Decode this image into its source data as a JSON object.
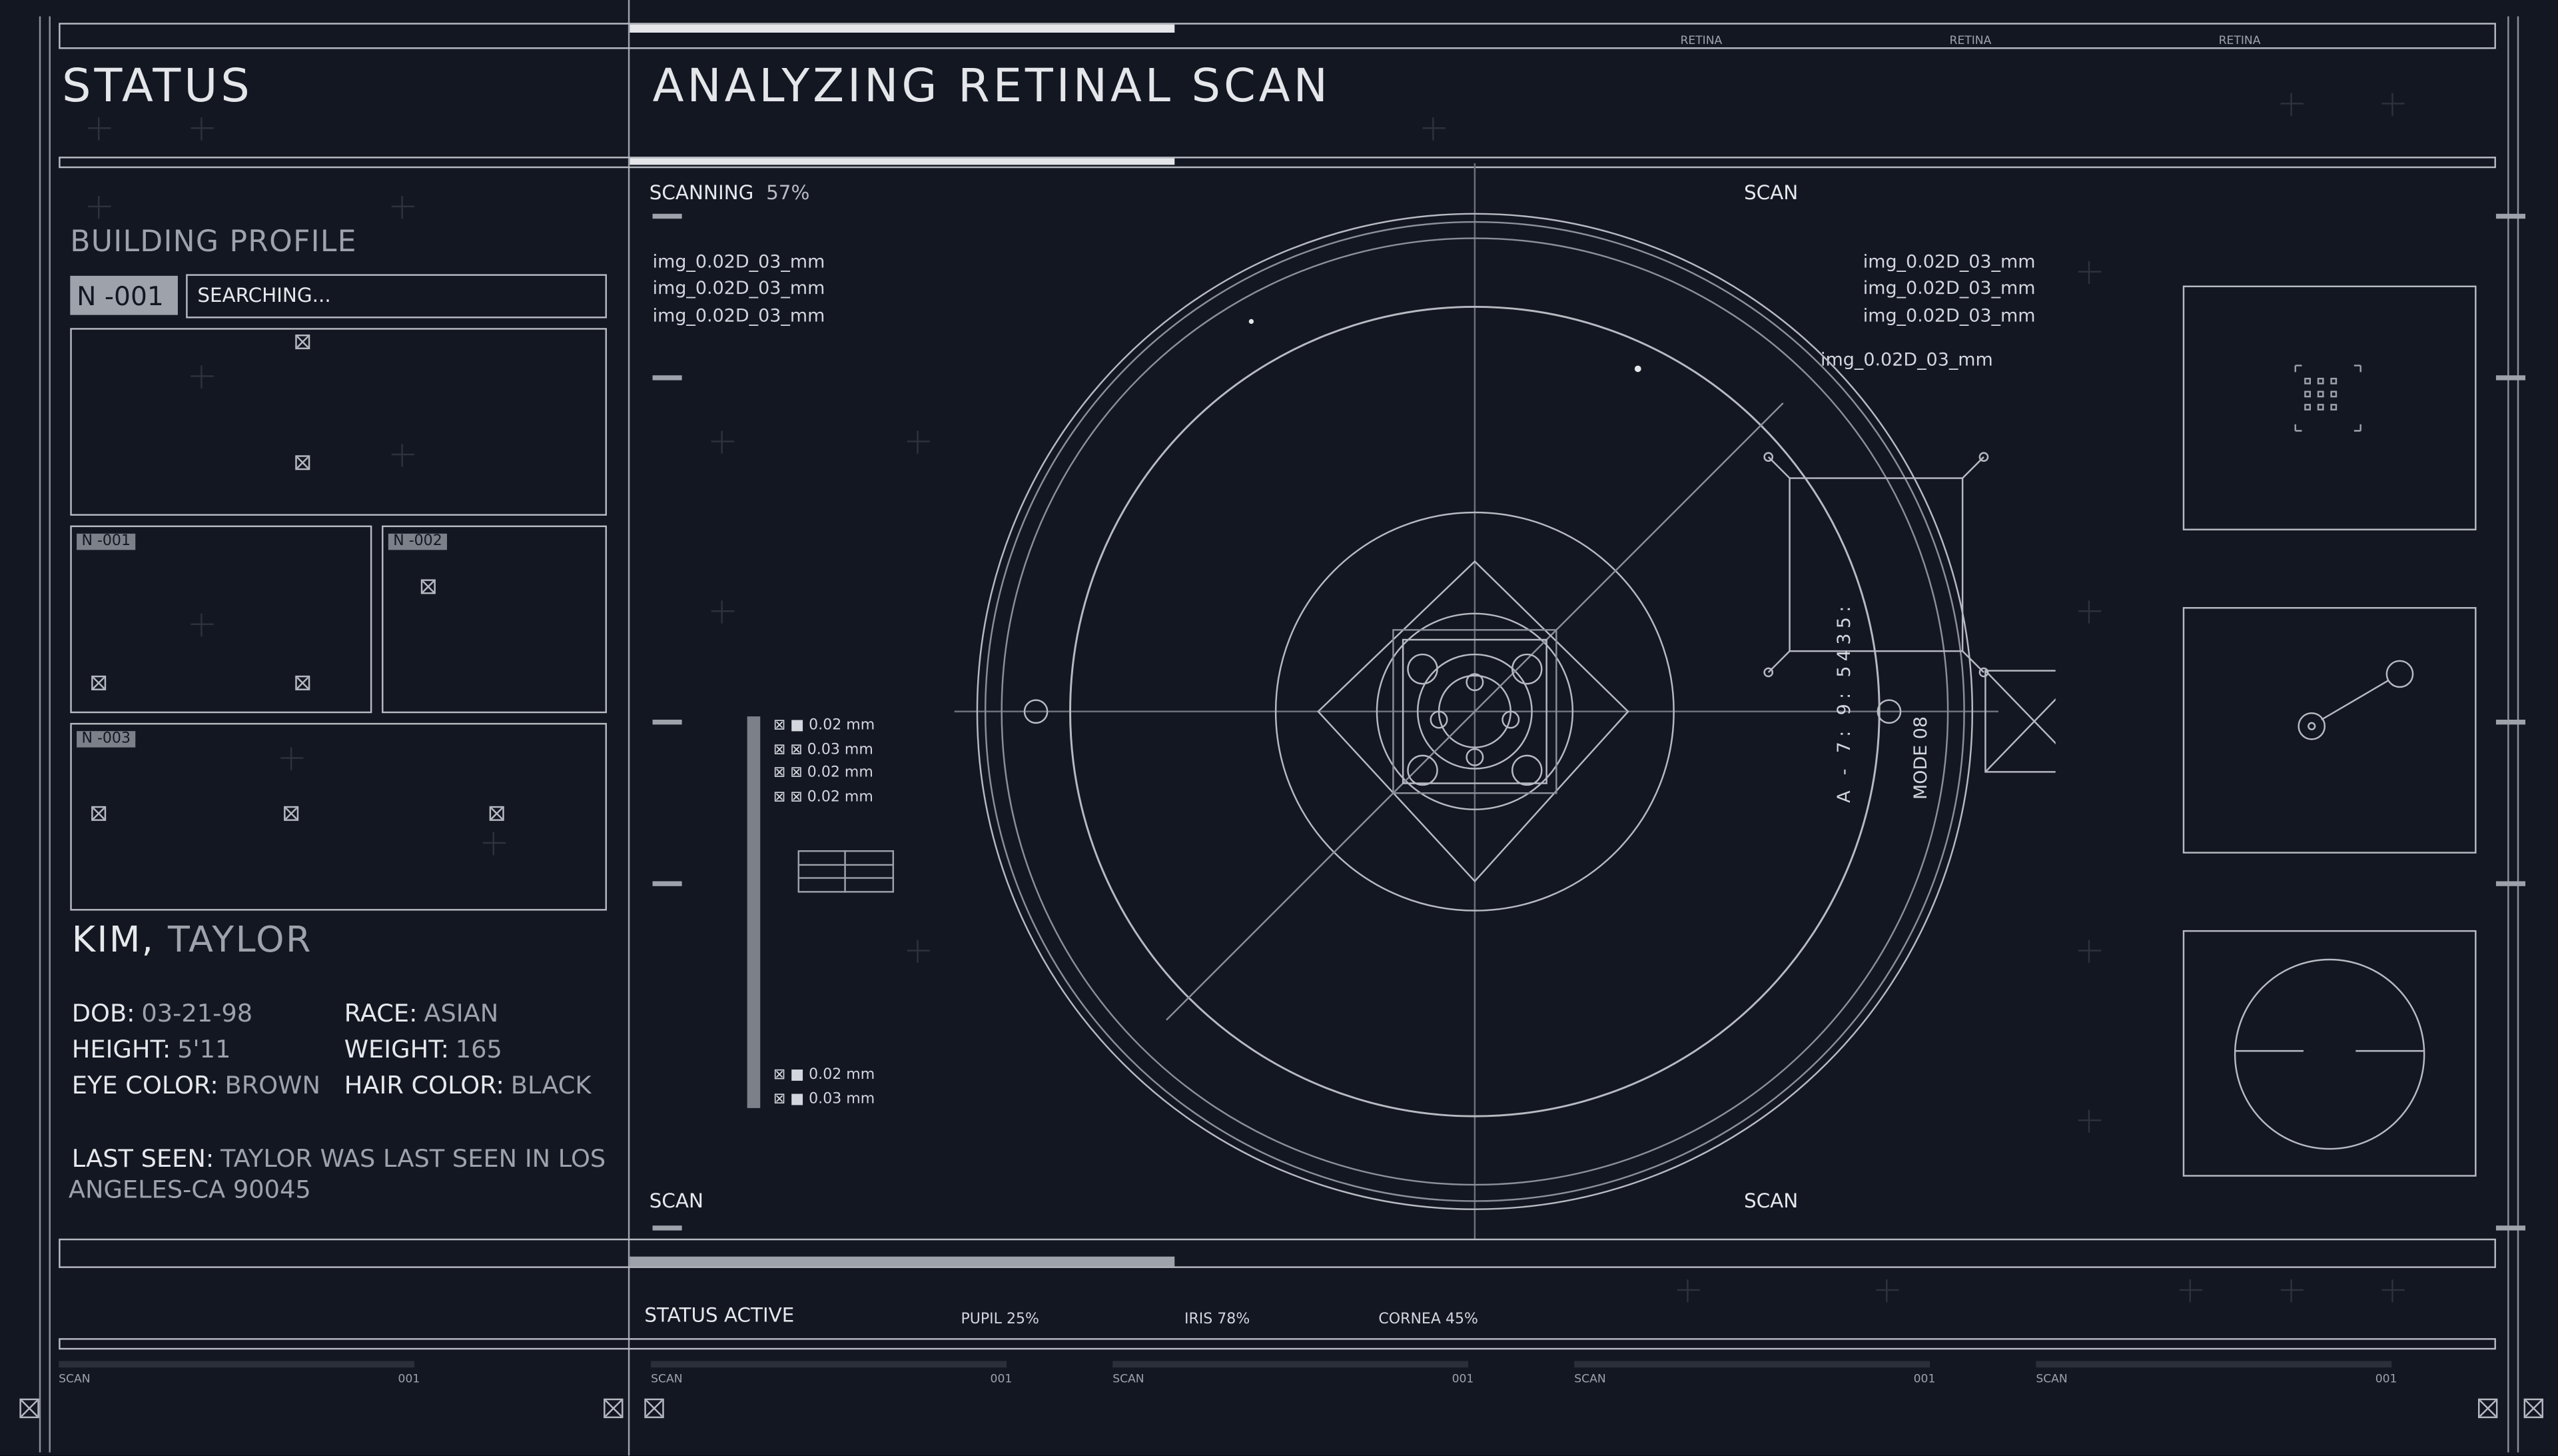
{
  "left_panel": {
    "title": "STATUS",
    "building_profile": "BUILDING PROFILE",
    "id_tag": "N -001",
    "search_status": "SEARCHING...",
    "thumb_tags": [
      "N -001",
      "N -002",
      "N -003"
    ],
    "name_last": "KIM,",
    "name_first": "TAYLOR",
    "fields": [
      {
        "key": "DOB:",
        "value": "03-21-98"
      },
      {
        "key": "RACE:",
        "value": "ASIAN"
      },
      {
        "key": "HEIGHT:",
        "value": "5'11"
      },
      {
        "key": "WEIGHT:",
        "value": "165"
      },
      {
        "key": "EYE COLOR:",
        "value": "BROWN"
      },
      {
        "key": "HAIR COLOR:",
        "value": "BLACK"
      }
    ],
    "last_seen_key": "LAST SEEN:",
    "last_seen_value_1": "TAYLOR WAS LAST SEEN IN LOS",
    "last_seen_value_2": "ANGELES-CA 90045"
  },
  "header": {
    "title": "ANALYZING RETINAL SCAN",
    "tabs": [
      "RETINA",
      "RETINA",
      "RETINA"
    ],
    "progress": 0.25
  },
  "scan_view": {
    "scanning_label": "SCANNING",
    "scanning_value": "57%",
    "scan_label_tr": "SCAN",
    "scan_label_bl": "SCAN",
    "scan_label_br": "SCAN",
    "files_left": [
      "img_0.02D_03_mm",
      "img_0.02D_03_mm",
      "img_0.02D_03_mm"
    ],
    "files_right": [
      "img_0.02D_03_mm",
      "img_0.02D_03_mm",
      "img_0.02D_03_mm"
    ],
    "file_annotation": "img_0.02D_03_mm",
    "measurements_top": [
      "0.02 mm",
      "0.03 mm",
      "0.02 mm",
      "0.02 mm"
    ],
    "measurements_bottom": [
      "0.02 mm",
      "0.03 mm"
    ],
    "rotated_code": "A - 7: 9: 5435:",
    "mode_label": "MODE 08"
  },
  "footer": {
    "status": "STATUS ACTIVE",
    "pupil": "PUPIL 25%",
    "iris": "IRIS 78%",
    "cornea": "CORNEA 45%",
    "bars": [
      {
        "left": "SCAN",
        "right": "001"
      },
      {
        "left": "SCAN",
        "right": "001"
      },
      {
        "left": "SCAN",
        "right": "001"
      },
      {
        "left": "SCAN",
        "right": "001"
      },
      {
        "left": "SCAN",
        "right": "001"
      }
    ]
  },
  "colors": {
    "background": "#131722",
    "line": "#b7bac1",
    "accent": "#e4e6ea"
  }
}
